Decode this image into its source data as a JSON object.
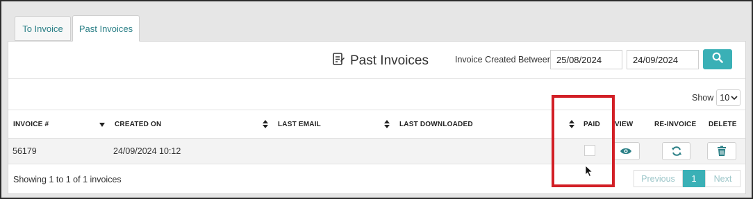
{
  "tabs": [
    {
      "label": "To Invoice"
    },
    {
      "label": "Past Invoices"
    }
  ],
  "header": {
    "title": "Past Invoices",
    "between_label": "Invoice Created Between",
    "date_from": "25/08/2024",
    "date_to": "24/09/2024",
    "search_icon": "search-icon"
  },
  "show": {
    "label": "Show",
    "value": "10"
  },
  "table": {
    "columns": [
      "INVOICE #",
      "CREATED ON",
      "LAST EMAIL",
      "LAST DOWNLOADED",
      "PAID",
      "VIEW",
      "RE-INVOICE",
      "DELETE"
    ],
    "rows": [
      {
        "invoice": "56179",
        "created_on": "24/09/2024 10:12",
        "last_email": "",
        "last_downloaded": "",
        "paid": false
      }
    ]
  },
  "footer": {
    "info": "Showing 1 to 1 of 1 invoices",
    "prev": "Previous",
    "page": "1",
    "next": "Next"
  },
  "colors": {
    "accent": "#3ab0b6",
    "tab_text": "#2a7f86",
    "highlight": "#d21f26"
  }
}
